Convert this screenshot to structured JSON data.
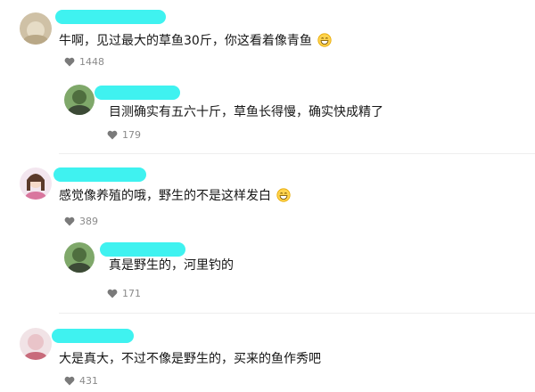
{
  "comments": [
    {
      "text": "牛啊，见过最大的草鱼30斤，你这看着像青鱼",
      "likes": "1448",
      "has_emoji": true,
      "reply": {
        "text": "目测确实有五六十斤，草鱼长得慢，确实快成精了",
        "likes": "179"
      }
    },
    {
      "text": "感觉像养殖的哦，野生的不是这样发白",
      "likes": "389",
      "has_emoji": true,
      "reply": {
        "text": "真是野生的，河里钓的",
        "likes": "171"
      }
    },
    {
      "text": "大是真大，不过不像是野生的，买来的鱼作秀吧",
      "likes": "431",
      "has_emoji": false
    }
  ],
  "colors": {
    "redaction": "#3ff2f0",
    "like_text": "#8a8a8a",
    "heart": "#7a7a7a"
  },
  "icons": {
    "like": "heart-icon",
    "emoji": "grin-emoji-icon"
  }
}
